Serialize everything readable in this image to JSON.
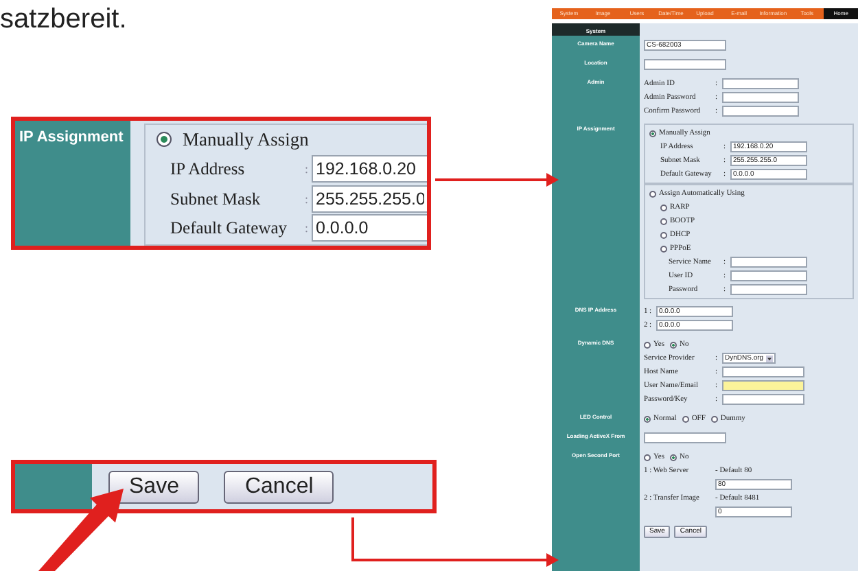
{
  "intro_text": "satzbereit.",
  "callouts": [
    {
      "kind": "ip_detail",
      "label": "IP Assignment",
      "option": {
        "label": "Manually Assign",
        "selected": true
      },
      "fields": [
        {
          "label": "IP Address",
          "sep": ":",
          "value": "192.168.0.20"
        },
        {
          "label": "Subnet Mask",
          "sep": ":",
          "value": "255.255.255.0"
        },
        {
          "label": "Default Gateway",
          "sep": ":",
          "value": "0.0.0.0"
        }
      ]
    },
    {
      "kind": "button_detail",
      "buttons": [
        "Save",
        "Cancel"
      ]
    }
  ],
  "screenshot": {
    "menu": [
      {
        "label": "System",
        "selected": false
      },
      {
        "label": "Image",
        "selected": false
      },
      {
        "label": "Users",
        "selected": false
      },
      {
        "label": "Date/Time",
        "selected": false
      },
      {
        "label": "Upload",
        "selected": false
      },
      {
        "label": "E-mail",
        "selected": false
      },
      {
        "label": "Information",
        "selected": false
      },
      {
        "label": "Tools",
        "selected": false
      },
      {
        "label": "Home",
        "selected": true
      }
    ],
    "section": "System",
    "settings": [
      {
        "kind": "field",
        "label": "Camera Name",
        "value": "CS-682003"
      },
      {
        "kind": "field",
        "label": "Location"
      },
      {
        "kind": "form",
        "label": "Admin",
        "fields": [
          {
            "label": "Admin ID",
            "sep": ":"
          },
          {
            "label": "Admin Password",
            "sep": ":"
          },
          {
            "label": "Confirm Password",
            "sep": ":"
          }
        ]
      },
      {
        "kind": "ip",
        "label": "IP Assignment",
        "options": [
          {
            "label": "Manually Assign",
            "selected": true,
            "fields": [
              {
                "label": "IP Address",
                "sep": ":",
                "value": "192.168.0.20"
              },
              {
                "label": "Subnet Mask",
                "sep": ":",
                "value": "255.255.255.0"
              },
              {
                "label": "Default Gateway",
                "sep": ":",
                "value": "0.0.0.0"
              }
            ]
          },
          {
            "label": "Assign Automatically Using",
            "selected": false,
            "methods": [
              {
                "label": "RARP",
                "selected": false
              },
              {
                "label": "BOOTP",
                "selected": false
              },
              {
                "label": "DHCP",
                "selected": false
              },
              {
                "label": "PPPoE",
                "selected": false
              }
            ],
            "fields": [
              {
                "label": "Service Name",
                "sep": ":"
              },
              {
                "label": "User ID",
                "sep": ":"
              },
              {
                "label": "Password",
                "sep": ":"
              }
            ]
          }
        ]
      },
      {
        "kind": "form",
        "label": "DNS IP Address",
        "fields": [
          {
            "label": "1",
            "sep": ":",
            "value": "0.0.0.0"
          },
          {
            "label": "2",
            "sep": ":",
            "value": "0.0.0.0"
          }
        ]
      },
      {
        "kind": "form",
        "label": "Dynamic DNS",
        "choices": [
          {
            "label": "Yes",
            "selected": false
          },
          {
            "label": "No",
            "selected": true
          }
        ],
        "fields": [
          {
            "label": "Service Provider",
            "sep": ":",
            "kind": "select",
            "value": "DynDNS.org"
          },
          {
            "label": "Host Name",
            "sep": ":"
          },
          {
            "label": "User Name/Email",
            "sep": ":",
            "highlighted": true
          },
          {
            "label": "Password/Key",
            "sep": ":"
          }
        ]
      },
      {
        "kind": "form",
        "label": "LED Control",
        "choices": [
          {
            "label": "Normal",
            "selected": true
          },
          {
            "label": "OFF",
            "selected": false
          },
          {
            "label": "Dummy",
            "selected": false
          }
        ]
      },
      {
        "kind": "field",
        "label": "Loading ActiveX From"
      },
      {
        "kind": "form",
        "label": "Open Second Port",
        "choices": [
          {
            "label": "Yes",
            "selected": false
          },
          {
            "label": "No",
            "selected": true
          }
        ],
        "ports": [
          {
            "label": "1 : Web Server",
            "hint": "- Default 80",
            "value": "80"
          },
          {
            "label": "2 : Transfer Image",
            "hint": "- Default 8481",
            "value": "0"
          }
        ]
      }
    ],
    "buttons": [
      "Save",
      "Cancel"
    ]
  }
}
